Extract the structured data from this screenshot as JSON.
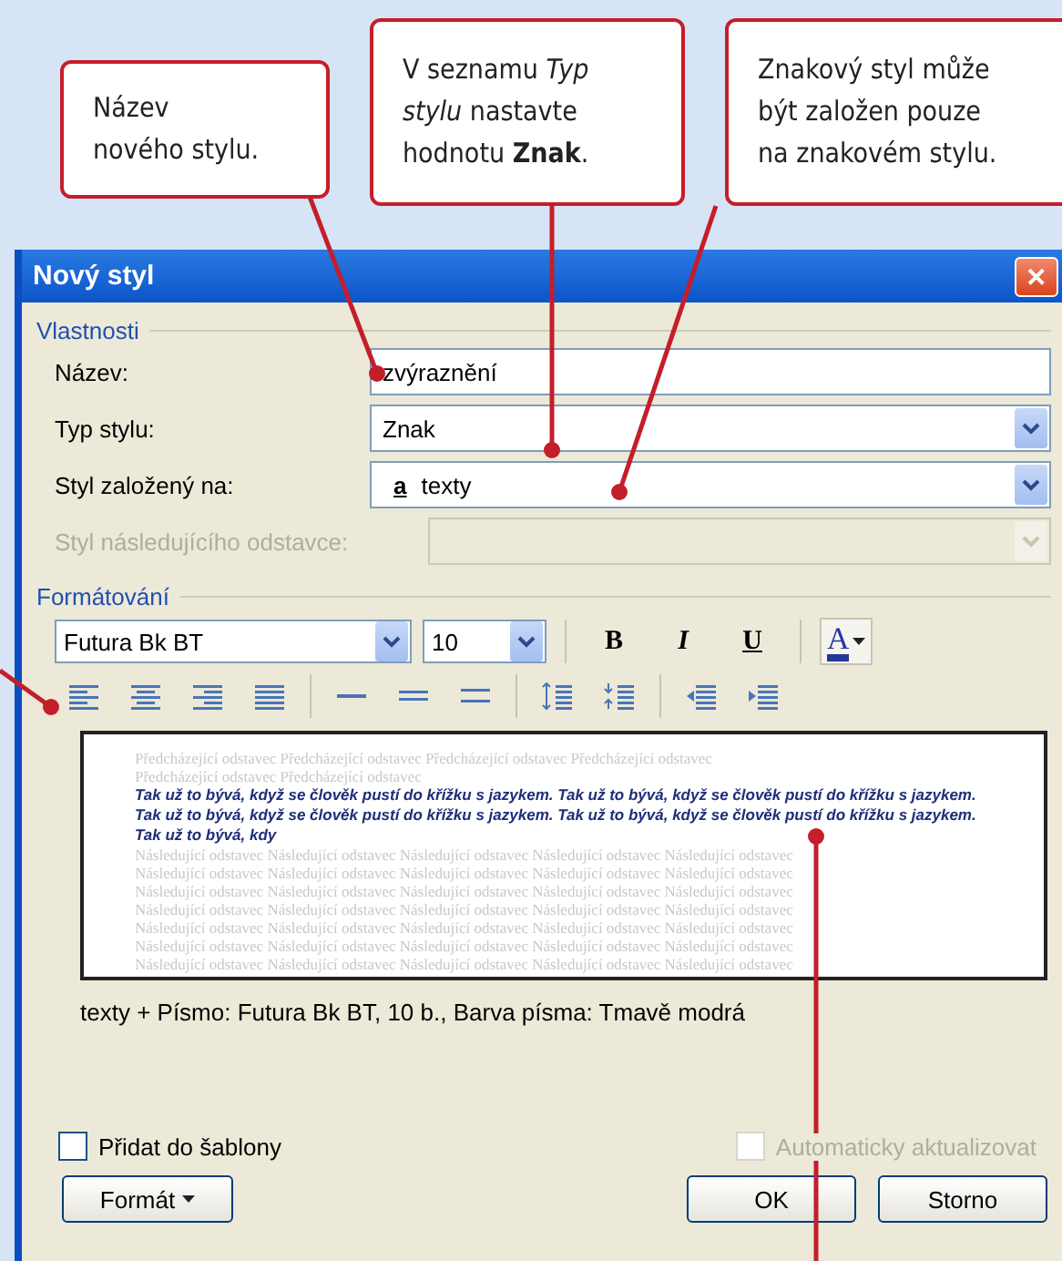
{
  "callouts": [
    {
      "lines": [
        "Název",
        "nového stylu."
      ]
    },
    {
      "lines": [
        "V seznamu *Typ*",
        "*stylu* nastavte",
        "hodnotu **Znak**."
      ]
    },
    {
      "lines": [
        "Znakový styl může",
        "být založen pouze",
        "na znakovém stylu."
      ]
    }
  ],
  "dialog": {
    "title": "Nový styl",
    "close": "✕",
    "properties": {
      "heading": "Vlastnosti",
      "rows": [
        {
          "kind": "text",
          "label": "Název:",
          "value": "zvýraznění",
          "disabled": false
        },
        {
          "kind": "combo",
          "label": "Typ stylu:",
          "value": "Znak",
          "disabled": false
        },
        {
          "kind": "combo",
          "label": "Styl založený na:",
          "glyph": "a",
          "value": "texty",
          "disabled": false
        },
        {
          "kind": "combo",
          "label": "Styl následujícího odstavce:",
          "disabled": true
        }
      ]
    },
    "formatting": {
      "heading": "Formátování",
      "font": "Futura Bk BT",
      "size": "10",
      "bold": "B",
      "italic": "I",
      "underline": "U",
      "color_letter": "A",
      "tools": [
        {
          "kind": "align-left"
        },
        {
          "kind": "align-center"
        },
        {
          "kind": "align-right"
        },
        {
          "kind": "justify"
        },
        {
          "kind": "sep"
        },
        {
          "kind": "single"
        },
        {
          "kind": "onehalf"
        },
        {
          "kind": "double"
        },
        {
          "kind": "sep"
        },
        {
          "kind": "space-more"
        },
        {
          "kind": "space-less"
        },
        {
          "kind": "sep"
        },
        {
          "kind": "indent-less"
        },
        {
          "kind": "indent-more"
        }
      ]
    },
    "preview": {
      "previous": [
        "Předcházející odstavec Předcházející odstavec Předcházející odstavec Předcházející odstavec",
        "Předcházející odstavec Předcházející odstavec"
      ],
      "sample": [
        "Tak už to bývá, když se člověk pustí do křížku s jazykem.  Tak už to bývá, když se člověk pustí do křížku s jazykem.",
        "Tak už to bývá, když se člověk pustí do křížku s jazykem.  Tak už to bývá, když se člověk pustí do křížku s jazykem.",
        "Tak už to bývá, kdy"
      ],
      "next": [
        "Následující odstavec Následující odstavec Následující odstavec Následující odstavec Následující odstavec",
        "Následující odstavec Následující odstavec Následující odstavec Následující odstavec Následující odstavec",
        "Následující odstavec Následující odstavec Následující odstavec Následující odstavec Následující odstavec",
        "Následující odstavec Následující odstavec Následující odstavec Následující odstavec Následující odstavec",
        "Následující odstavec Následující odstavec Následující odstavec Následující odstavec Následující odstavec",
        "Následující odstavec Následující odstavec Následující odstavec Následující odstavec Následující odstavec",
        "Následující odstavec Následující odstavec Následující odstavec Následující odstavec Následující odstavec"
      ]
    },
    "description": "texty + Písmo: Futura Bk BT, 10 b., Barva písma: Tmavě modrá",
    "checkboxes": [
      {
        "label": "Přidat do šablony",
        "checked": false,
        "disabled": false
      },
      {
        "label": "Automaticky aktualizovat",
        "checked": false,
        "disabled": true
      }
    ],
    "buttons": [
      {
        "label": "Formát",
        "kind": "menu"
      },
      {
        "label": "OK",
        "kind": "plain"
      },
      {
        "label": "Storno",
        "kind": "plain"
      }
    ]
  }
}
